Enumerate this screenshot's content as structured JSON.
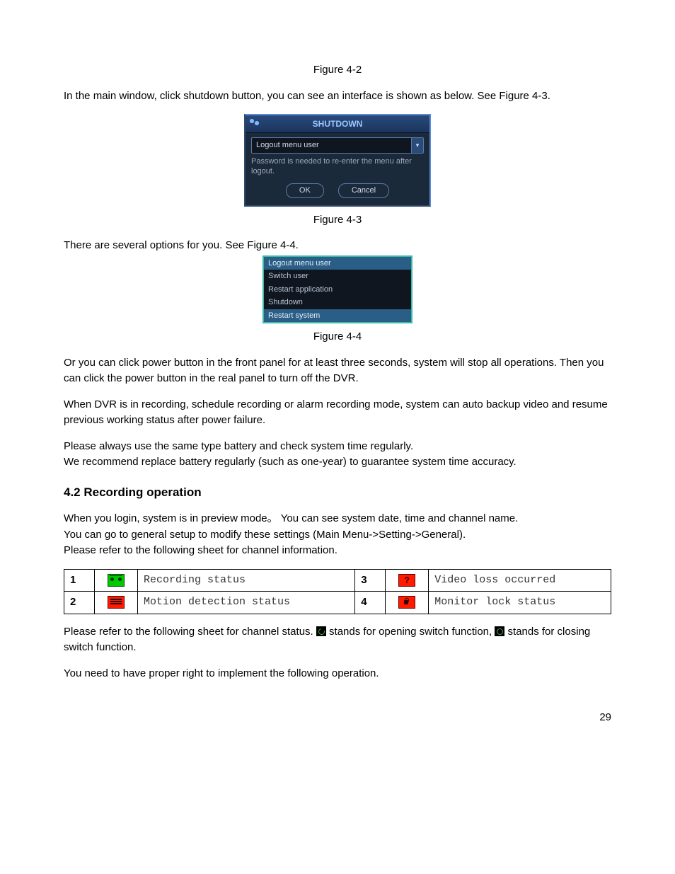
{
  "fig42": "Figure 4-2",
  "para1": "In the main window, click shutdown button, you can see an interface is shown as below. See Figure 4-3.",
  "shutdown": {
    "title": "SHUTDOWN",
    "selected": "Logout menu user",
    "hint": "Password is needed to re-enter the menu after logout.",
    "ok": "OK",
    "cancel": "Cancel"
  },
  "fig43": "Figure 4-3",
  "para2": "There are several options for you. See Figure 4-4.",
  "options": [
    "Logout menu user",
    "Switch user",
    "Restart application",
    "Shutdown",
    "Restart system"
  ],
  "fig44": "Figure 4-4",
  "para3": "Or you can click power button in the front panel for at least three seconds, system will stop all operations. Then you can click the power button in the real panel to turn off the DVR.",
  "para4": "When DVR is in recording, schedule recording or alarm recording mode, system can auto backup video and resume previous working status after power failure.",
  "para5": "Please always use the same type battery and check system time regularly.\nWe recommend replace battery regularly (such as one-year) to guarantee system time accuracy.",
  "section": "4.2  Recording operation",
  "para6": "When you login, system is in preview mode。 You can see system date, time and channel name.\nYou can go to general setup to modify these settings (Main Menu->Setting->General).\nPlease refer to the following sheet for channel information.",
  "table": {
    "r1": {
      "n": "1",
      "d": "Recording status"
    },
    "r2": {
      "n": "2",
      "d": "Motion detection status"
    },
    "r3": {
      "n": "3",
      "d": "Video loss occurred"
    },
    "r4": {
      "n": "4",
      "d": "Monitor lock status"
    }
  },
  "para7a": "Please refer to the following sheet for channel status. ",
  "para7b": " stands for opening switch function, ",
  "para7c": " stands for closing switch function.",
  "para8": "You need to have proper right to implement the following operation.",
  "page": "29"
}
